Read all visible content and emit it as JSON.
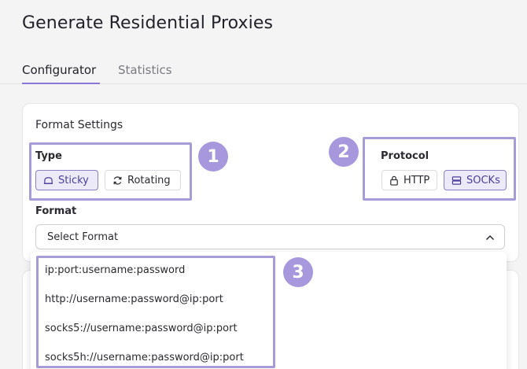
{
  "page": {
    "title": "Generate Residential Proxies"
  },
  "tabs": [
    {
      "label": "Configurator",
      "active": true
    },
    {
      "label": "Statistics",
      "active": false
    }
  ],
  "format_settings": {
    "title": "Format Settings",
    "type": {
      "label": "Type",
      "options": [
        {
          "label": "Sticky",
          "icon": "sticky-icon",
          "selected": true
        },
        {
          "label": "Rotating",
          "icon": "rotate-icon",
          "selected": false
        }
      ]
    },
    "protocol": {
      "label": "Protocol",
      "options": [
        {
          "label": "HTTP",
          "icon": "lock-icon",
          "selected": false
        },
        {
          "label": "SOCKs",
          "icon": "server-icon",
          "selected": true
        }
      ]
    },
    "format": {
      "label": "Format",
      "placeholder": "Select Format",
      "options": [
        "ip:port:username:password",
        "http://username:password@ip:port",
        "socks5://username:password@ip:port",
        "socks5h://username:password@ip:port"
      ]
    }
  },
  "annotations": [
    "1",
    "2",
    "3"
  ],
  "colors": {
    "accent": "#8b78d6",
    "highlight": "#a79bd8",
    "badge": "#a797dc",
    "selected_bg": "#ece9f8"
  }
}
